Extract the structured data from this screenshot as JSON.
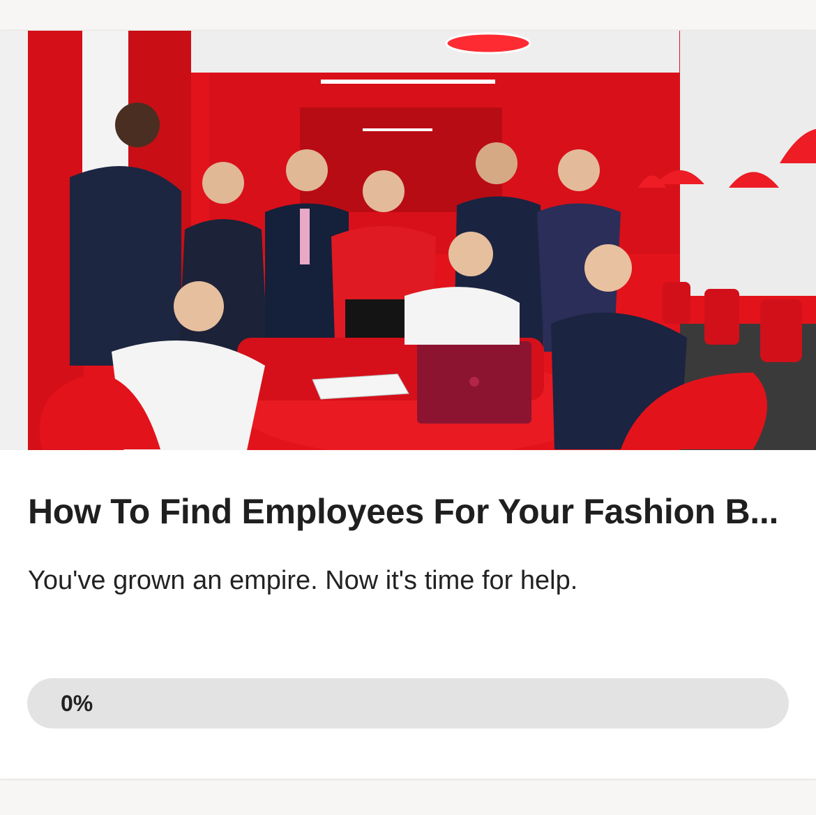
{
  "article": {
    "image_alt": "Team of fashion business employees posing in a red office",
    "title": "How To Find Employees For Your Fashion B...",
    "subtitle": "You've grown an empire. Now it's time for help.",
    "progress": {
      "value_percent": 0,
      "label": "0%"
    }
  },
  "colors": {
    "accent_red": "#e0141c",
    "track": "#e3e3e3",
    "text": "#1f1f1f"
  }
}
